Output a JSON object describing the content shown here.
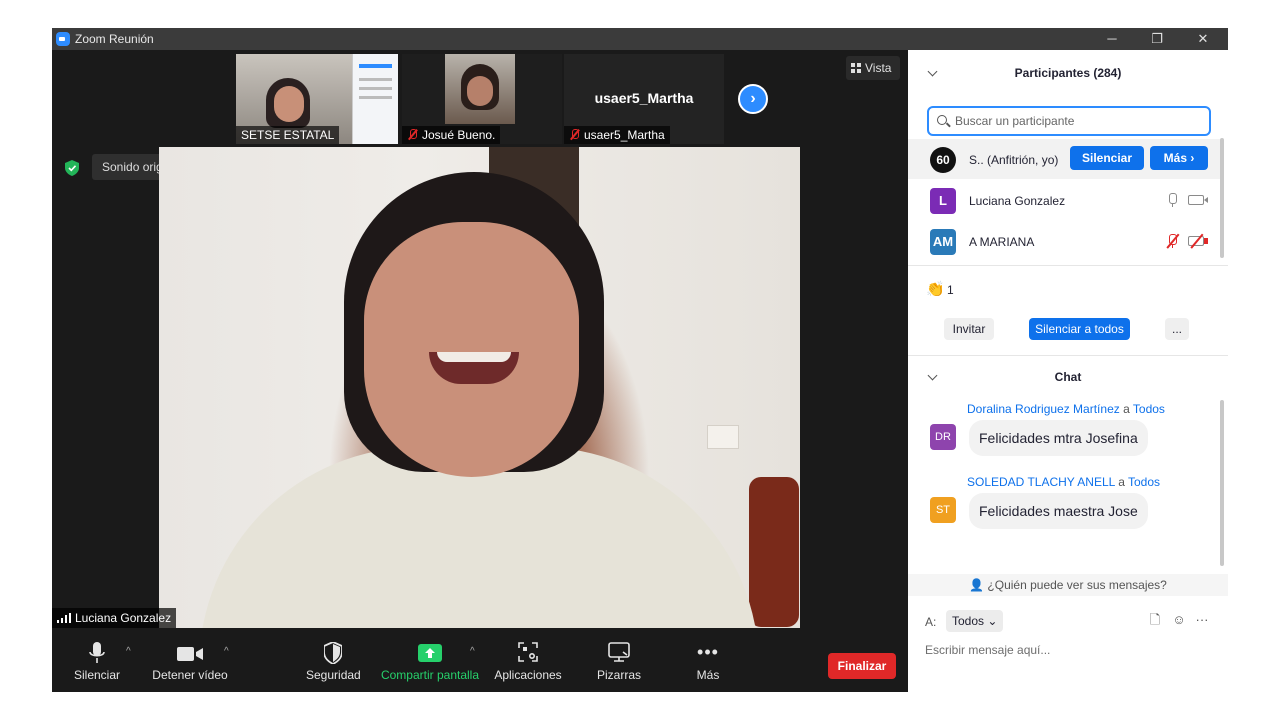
{
  "window": {
    "title": "Zoom Reunión",
    "controls": {
      "minimize": "─",
      "restore": "❐",
      "close": "✕"
    }
  },
  "thumbnails": [
    {
      "name": "SETSE ESTATAL",
      "muted": false
    },
    {
      "name": "Josué Bueno.",
      "muted": true
    },
    {
      "name": "usaer5_Martha",
      "label": "usaer5_Martha",
      "muted": true
    }
  ],
  "view_button": "Vista",
  "original_sound": "Sonido original: desactivado",
  "main_speaker": "Luciana Gonzalez",
  "toolbar": {
    "mute": "Silenciar",
    "stop_video": "Detener vídeo",
    "security": "Seguridad",
    "share_screen": "Compartir pantalla",
    "apps": "Aplicaciones",
    "whiteboards": "Pizarras",
    "more": "Más",
    "end": "Finalizar",
    "caret": "^"
  },
  "participants": {
    "title": "Participantes (284)",
    "search_placeholder": "Buscar un participante",
    "list": [
      {
        "avatar": "60",
        "name": "S.. (Anfitrión, yo)",
        "btn_mute": "Silenciar",
        "btn_more": "Más ›"
      },
      {
        "avatar": "L",
        "name": "Luciana Gonzalez",
        "color": "#7b2bb5"
      },
      {
        "avatar": "AM",
        "name": "A MARIANA",
        "color": "#2a7ab8"
      }
    ],
    "reaction_icon": "👏",
    "reaction_count": "1",
    "invite": "Invitar",
    "mute_all": "Silenciar a todos",
    "more": "..."
  },
  "chat": {
    "title": "Chat",
    "messages": [
      {
        "initials": "DR",
        "sender": "Doralina Rodriguez Martínez",
        "to_word": "a",
        "recipient": "Todos",
        "text": "Felicidades mtra Josefina",
        "color": "#8e44ad"
      },
      {
        "initials": "ST",
        "sender": "SOLEDAD TLACHY ANELL",
        "to_word": "a",
        "recipient": "Todos",
        "text": "Felicidades maestra Jose",
        "color": "#f0a020"
      }
    ],
    "who_can_see": "¿Quién puede ver sus mensajes?",
    "to_label": "A:",
    "to_value": "Todos ⌄",
    "compose_placeholder": "Escribir mensaje aquí...",
    "icons": {
      "file": "🗋",
      "emoji": "☺",
      "more": "···"
    }
  },
  "colors": {
    "accent": "#0e71eb",
    "danger": "#e02828",
    "share_green": "#26d06b"
  }
}
